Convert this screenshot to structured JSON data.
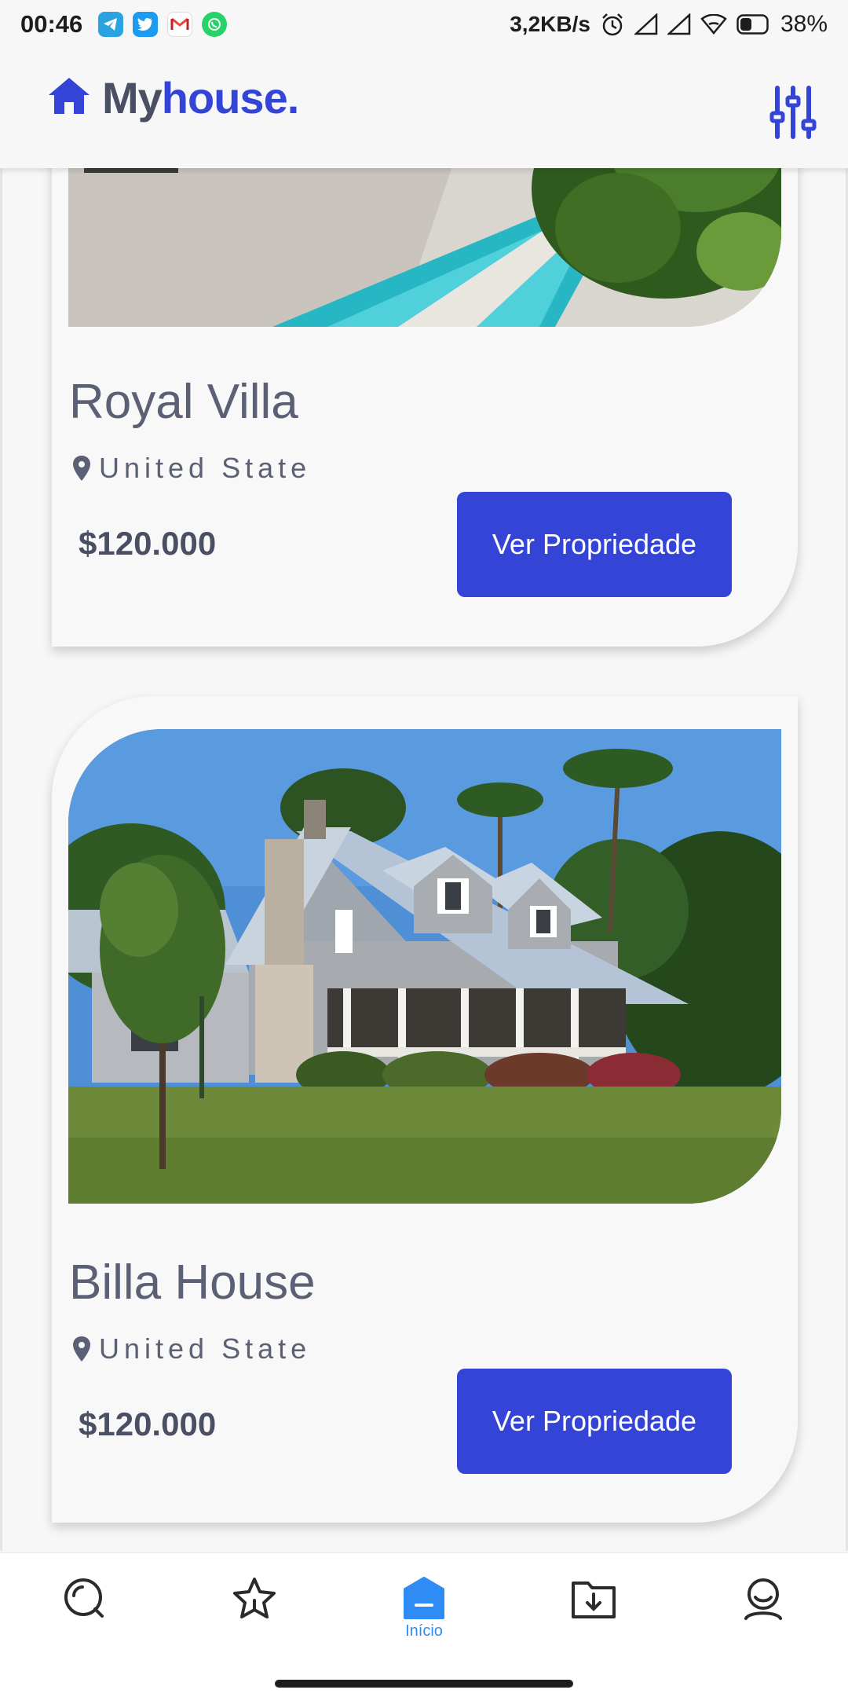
{
  "status_bar": {
    "time": "00:46",
    "net_speed": "3,2KB/s",
    "battery": "38%",
    "notification_icons": [
      "telegram-icon",
      "twitter-icon",
      "gmail-icon",
      "whatsapp-icon"
    ]
  },
  "header": {
    "logo_part1": "My",
    "logo_part2": "house.",
    "brand_color": "#3344d6"
  },
  "listings": [
    {
      "title": "Royal Villa",
      "location": "United State",
      "price": "$120.000",
      "button_label": "Ver Propriedade"
    },
    {
      "title": "Billa House",
      "location": "United State",
      "price": "$120.000",
      "button_label": "Ver Propriedade"
    }
  ],
  "bottom_nav": {
    "items": [
      {
        "icon": "search-icon"
      },
      {
        "icon": "star-icon"
      },
      {
        "icon": "home-icon",
        "label": "Início",
        "active": true
      },
      {
        "icon": "download-folder-icon"
      },
      {
        "icon": "profile-icon"
      }
    ],
    "active_color": "#2f8cf5"
  }
}
